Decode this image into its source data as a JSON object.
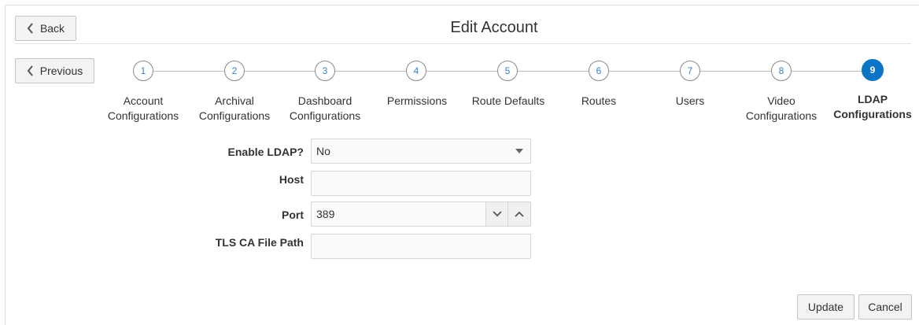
{
  "header": {
    "title": "Edit Account",
    "back_label": "Back",
    "previous_label": "Previous"
  },
  "steps": [
    {
      "number": "1",
      "label_line1": "Account",
      "label_line2": "Configurations"
    },
    {
      "number": "2",
      "label_line1": "Archival",
      "label_line2": "Configurations"
    },
    {
      "number": "3",
      "label_line1": "Dashboard",
      "label_line2": "Configurations"
    },
    {
      "number": "4",
      "label_line1": "Permissions",
      "label_line2": ""
    },
    {
      "number": "5",
      "label_line1": "Route Defaults",
      "label_line2": ""
    },
    {
      "number": "6",
      "label_line1": "Routes",
      "label_line2": ""
    },
    {
      "number": "7",
      "label_line1": "Users",
      "label_line2": ""
    },
    {
      "number": "8",
      "label_line1": "Video",
      "label_line2": "Configurations"
    },
    {
      "number": "9",
      "label_line1": "LDAP",
      "label_line2": "Configurations"
    }
  ],
  "active_step": 9,
  "form": {
    "enable_ldap": {
      "label": "Enable LDAP?",
      "value": "No"
    },
    "host": {
      "label": "Host",
      "value": ""
    },
    "port": {
      "label": "Port",
      "value": "389"
    },
    "tls_ca": {
      "label": "TLS CA File Path",
      "value": ""
    }
  },
  "footer": {
    "update_label": "Update",
    "cancel_label": "Cancel"
  },
  "colors": {
    "accent": "#0b74c4",
    "step_number": "#3a82c6"
  }
}
